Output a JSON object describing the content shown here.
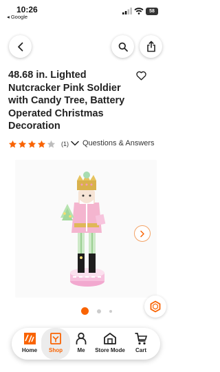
{
  "status_bar": {
    "time": "10:26",
    "carrier": "◂ Google",
    "battery": "58"
  },
  "product": {
    "title": "48.68 in. Lighted Nutcracker Pink Soldier with Candy Tree, Battery Operated Christmas Decoration",
    "rating": 4,
    "max_rating": 5,
    "review_count": "(1)",
    "qa_label": "Questions & Answers"
  },
  "gallery": {
    "current_index": 1,
    "total_dots": 3
  },
  "nav": {
    "items": [
      {
        "label": "Home"
      },
      {
        "label": "Shop"
      },
      {
        "label": "Me"
      },
      {
        "label": "Store Mode"
      },
      {
        "label": "Cart"
      }
    ],
    "active": "Shop"
  },
  "colors": {
    "accent": "#f96302",
    "star": "#f96302",
    "star_empty": "#bdbdbd"
  }
}
